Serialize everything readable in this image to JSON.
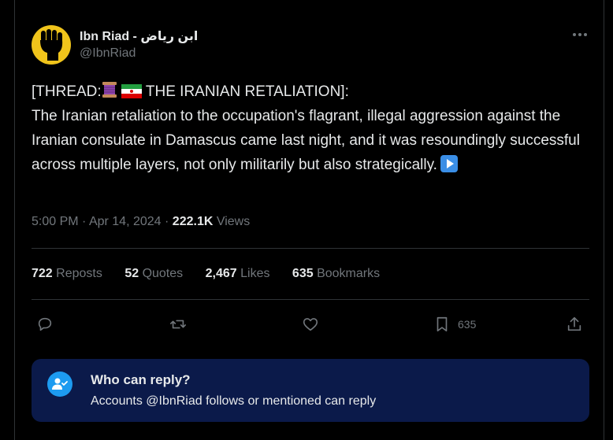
{
  "author": {
    "display_name": "Ibn Riad - ابن رياض",
    "handle": "@IbnRiad"
  },
  "tweet": {
    "line1": "[THREAD:",
    "line1_rest": " THE IRANIAN RETALIATION]:",
    "body": "The Iranian retaliation to the occupation's flagrant, illegal aggression against the Iranian consulate in Damascus came last night, and it was resoundingly successful across multiple layers, not only militarily but also strategically."
  },
  "meta": {
    "time": "5:00 PM",
    "date": "Apr 14, 2024",
    "views_count": "222.1K",
    "views_label": "Views"
  },
  "stats": [
    {
      "count": "722",
      "label": "Reposts"
    },
    {
      "count": "52",
      "label": "Quotes"
    },
    {
      "count": "2,467",
      "label": "Likes"
    },
    {
      "count": "635",
      "label": "Bookmarks"
    }
  ],
  "actions": {
    "bookmark_count": "635"
  },
  "reply_restriction": {
    "title": "Who can reply?",
    "subtitle": "Accounts @IbnRiad follows or mentioned can reply"
  },
  "icons": {
    "avatar": "raised-fist-icon",
    "more": "more-dots-icon",
    "reply": "reply-icon",
    "repost": "repost-icon",
    "like": "heart-icon",
    "bookmark": "bookmark-icon",
    "share": "share-icon",
    "thread": "thread-spool-icon",
    "flag": "iran-flag-icon",
    "play": "play-button-icon",
    "who_can_reply": "people-mention-icon"
  },
  "colors": {
    "background": "#000000",
    "text": "#e7e9ea",
    "muted": "#71767b",
    "accent": "#1d9bf0",
    "reply_box": "#0b1a4a"
  }
}
